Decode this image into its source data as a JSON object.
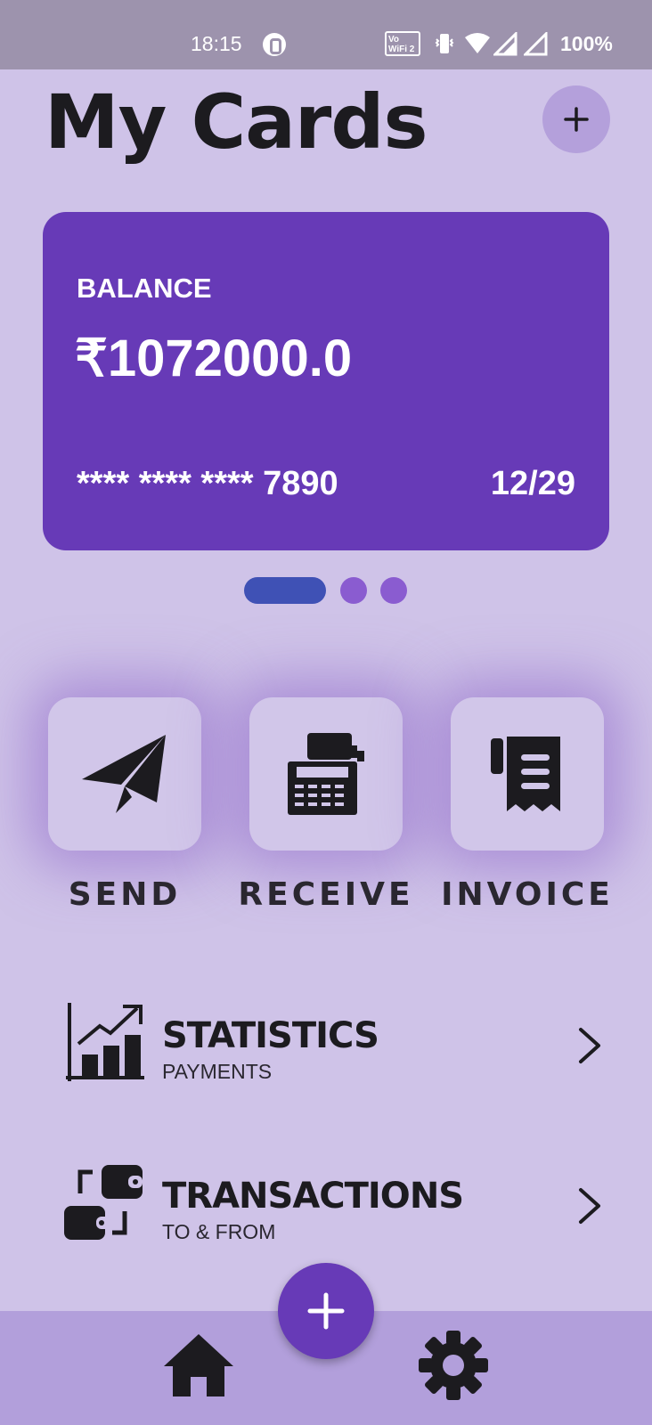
{
  "status_bar": {
    "time": "18:15",
    "vowifi_top": "Vo",
    "vowifi_bottom": "WiFi 2",
    "battery": "100%"
  },
  "header": {
    "title": "My Cards",
    "add_icon": "plus-icon"
  },
  "card": {
    "balance_label": "BALANCE",
    "balance_value": "₹1072000.0",
    "card_number": "**** **** **** 7890",
    "expiry": "12/29",
    "color": "#673ab7"
  },
  "pager": {
    "count": 3,
    "active_index": 0
  },
  "actions": [
    {
      "label": "SEND",
      "icon": "paper-plane-icon"
    },
    {
      "label": "RECEIVE",
      "icon": "cash-register-icon"
    },
    {
      "label": "INVOICE",
      "icon": "receipt-icon"
    }
  ],
  "menu": [
    {
      "title": "STATISTICS",
      "subtitle": "PAYMENTS",
      "icon": "bar-chart-growth-icon"
    },
    {
      "title": "TRANSACTIONS",
      "subtitle": "TO & FROM",
      "icon": "wallet-transfer-icon"
    }
  ],
  "bottom_nav": {
    "items": [
      {
        "icon": "home-icon"
      },
      {
        "icon": "settings-icon"
      }
    ],
    "fab_icon": "plus-icon"
  },
  "colors": {
    "background": "#cfc3e8",
    "accent": "#673ab7",
    "pager_active": "#3f51b5",
    "nav_background": "#b29fdb"
  }
}
